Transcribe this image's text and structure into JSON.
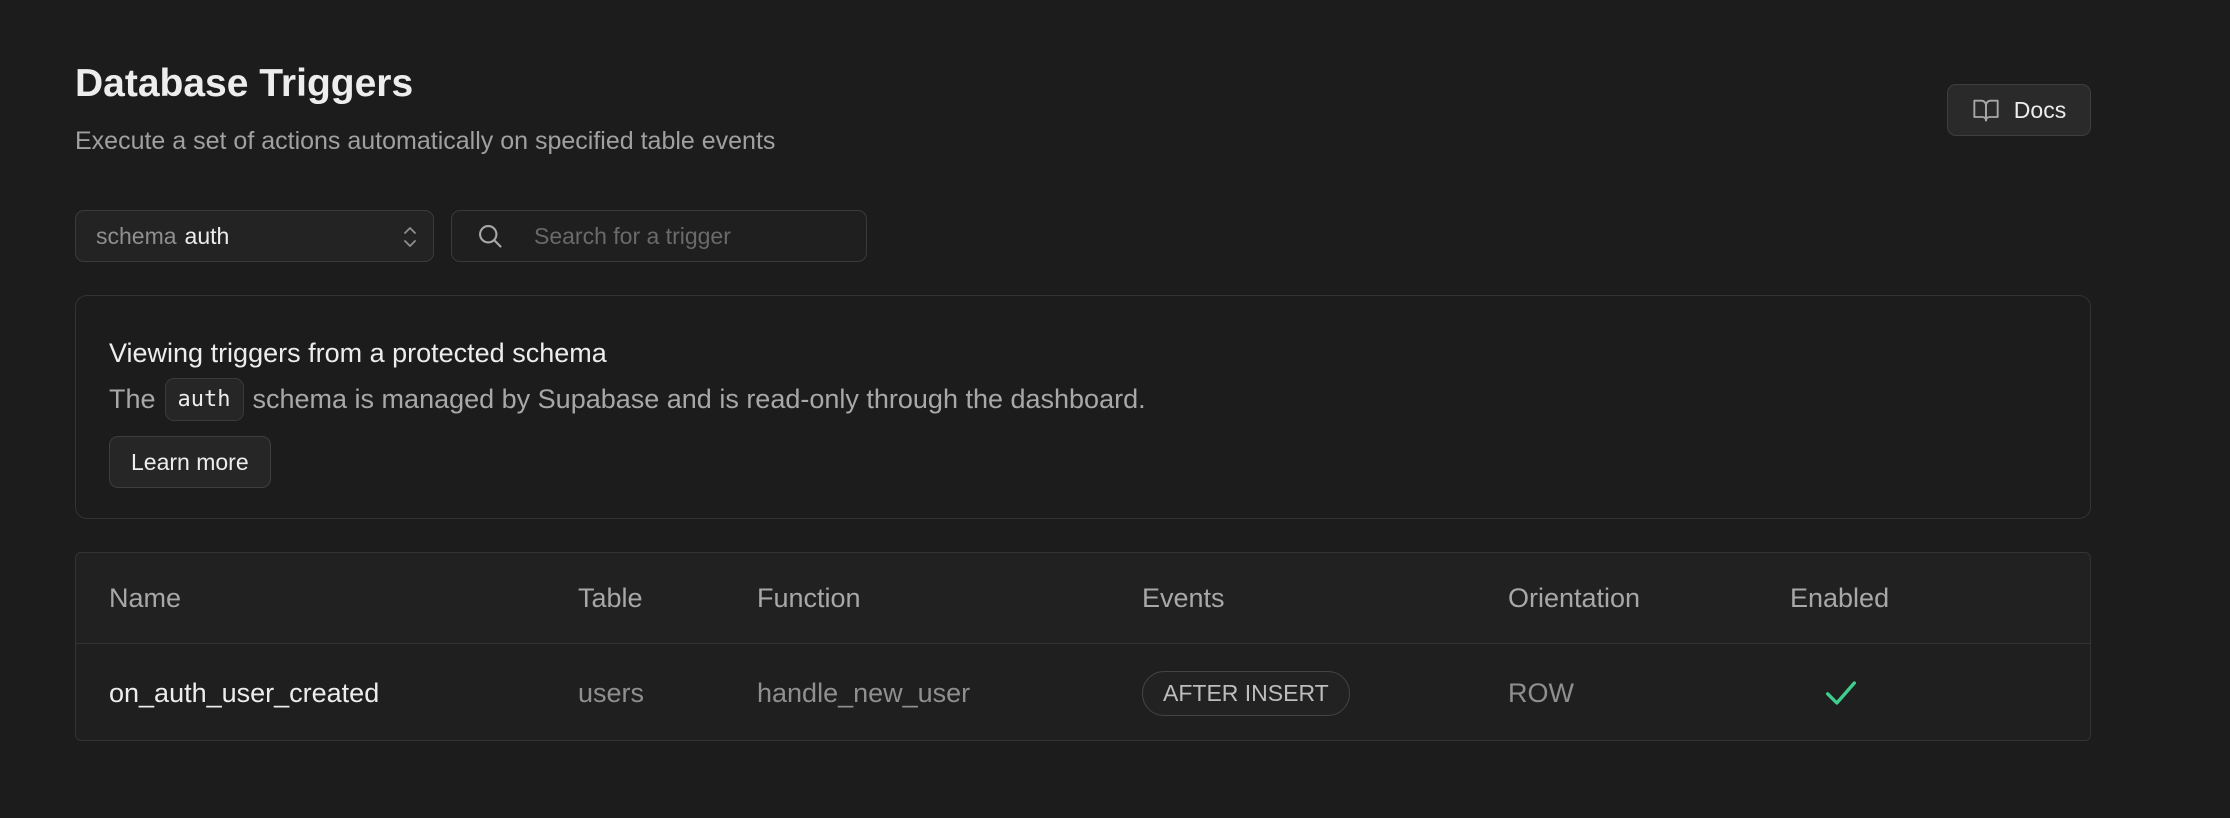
{
  "header": {
    "title": "Database Triggers",
    "subtitle": "Execute a set of actions automatically on specified table events",
    "docs_label": "Docs"
  },
  "filters": {
    "schema_label": "schema",
    "schema_value": "auth",
    "search_placeholder": "Search for a trigger"
  },
  "notice": {
    "title": "Viewing triggers from a protected schema",
    "body_prefix": "The",
    "code": "auth",
    "body_suffix": "schema is managed by Supabase and is read-only through the dashboard.",
    "button_label": "Learn more"
  },
  "table": {
    "columns": [
      "Name",
      "Table",
      "Function",
      "Events",
      "Orientation",
      "Enabled"
    ],
    "rows": [
      {
        "name": "on_auth_user_created",
        "table": "users",
        "function": "handle_new_user",
        "event": "AFTER INSERT",
        "orientation": "ROW",
        "enabled": true
      }
    ]
  },
  "colors": {
    "background": "#1c1c1c",
    "accent_green": "#3ecf8e"
  },
  "icons": {
    "docs": "book-open-icon",
    "schema_chevron": "chevrons-up-down-icon",
    "search": "search-icon",
    "enabled": "check-icon"
  }
}
